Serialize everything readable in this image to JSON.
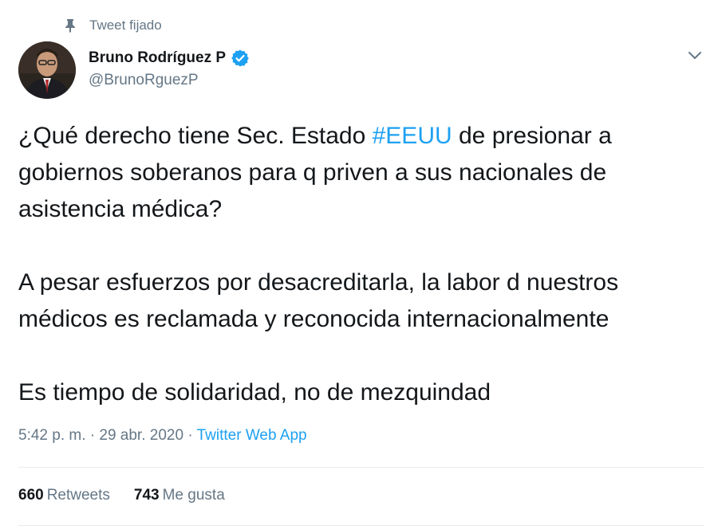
{
  "pinned": {
    "label": "Tweet fijado",
    "icon": "pin-icon"
  },
  "author": {
    "display_name": "Bruno Rodríguez P",
    "handle": "@BrunoRguezP",
    "verified_icon": "verified-badge-icon",
    "avatar_icon": "avatar-photo"
  },
  "menu": {
    "icon": "chevron-down-icon"
  },
  "tweet": {
    "p1_before": "¿Qué derecho tiene Sec. Estado ",
    "hashtag": "#EEUU",
    "p1_after": " de presionar a gobiernos soberanos para q priven a sus nacionales de asistencia médica?",
    "p2": "A pesar esfuerzos por desacreditarla, la labor d nuestros médicos es reclamada y reconocida internacionalmente",
    "p3": "Es tiempo de solidaridad, no de mezquindad"
  },
  "meta": {
    "time": "5:42 p. m.",
    "separator": " · ",
    "date": "29 abr. 2020",
    "source": "Twitter Web App"
  },
  "stats": {
    "retweets_count": "660",
    "retweets_label": "Retweets",
    "likes_count": "743",
    "likes_label": "Me gusta"
  },
  "colors": {
    "accent": "#1da1f2",
    "secondary_text": "#657786",
    "divider": "#e6ecf0"
  }
}
